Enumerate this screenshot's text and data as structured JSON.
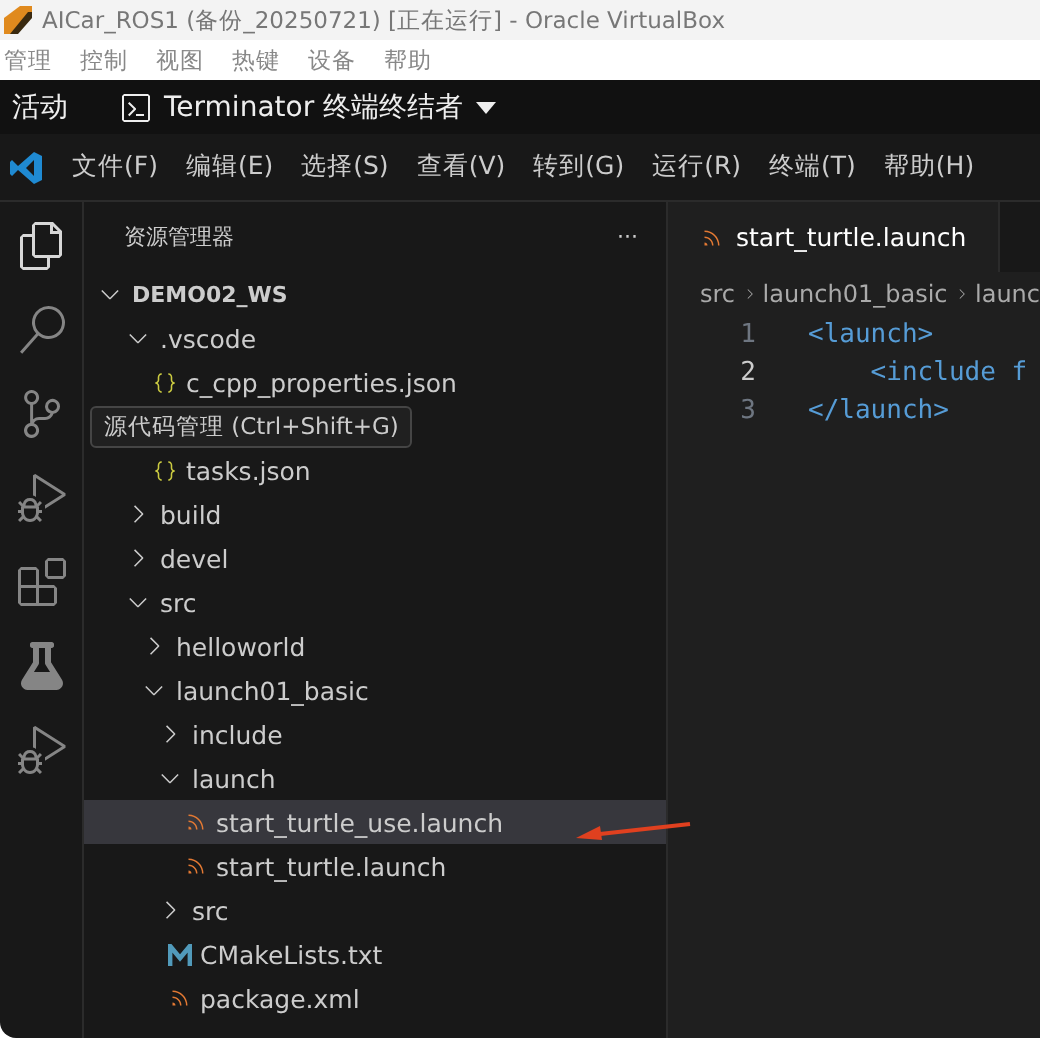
{
  "host_window": {
    "title": "AICar_ROS1 (备份_20250721) [正在运行] - Oracle VirtualBox",
    "menu": [
      "管理",
      "控制",
      "视图",
      "热键",
      "设备",
      "帮助"
    ]
  },
  "top_bar": {
    "activities": "活动",
    "app": "Terminator 终端终结者"
  },
  "editor_menu": [
    "文件(F)",
    "编辑(E)",
    "选择(S)",
    "查看(V)",
    "转到(G)",
    "运行(R)",
    "终端(T)",
    "帮助(H)"
  ],
  "activity_bar": [
    {
      "kind": "files",
      "selected": true
    },
    {
      "kind": "search",
      "selected": false
    },
    {
      "kind": "git",
      "selected": false
    },
    {
      "kind": "debug",
      "selected": false
    },
    {
      "kind": "extensions",
      "selected": false
    },
    {
      "kind": "flask",
      "selected": false
    },
    {
      "kind": "ros",
      "selected": false
    }
  ],
  "sidebar": {
    "title": "资源管理器",
    "more": "···",
    "tree": [
      {
        "kind": "folder",
        "label": "DEMO02_WS",
        "expanded": true,
        "selected": false,
        "children": [
          {
            "kind": "folder",
            "label": ".vscode",
            "expanded": true,
            "selected": false,
            "children": [
              {
                "kind": "json_file",
                "label": "c_cpp_properties.json",
                "selected": false
              },
              {
                "kind": "tooltip",
                "label": "源代码管理 (Ctrl+Shift+G)"
              },
              {
                "kind": "json_file",
                "label": "tasks.json",
                "selected": false
              }
            ]
          },
          {
            "kind": "folder",
            "label": "build",
            "expanded": false,
            "selected": false
          },
          {
            "kind": "folder",
            "label": "devel",
            "expanded": false,
            "selected": false
          },
          {
            "kind": "folder",
            "label": "src",
            "expanded": true,
            "selected": false,
            "children": [
              {
                "kind": "folder",
                "label": "helloworld",
                "expanded": false,
                "selected": false
              },
              {
                "kind": "folder",
                "label": "launch01_basic",
                "expanded": true,
                "selected": false,
                "children": [
                  {
                    "kind": "folder",
                    "label": "include",
                    "expanded": false,
                    "selected": false
                  },
                  {
                    "kind": "folder",
                    "label": "launch",
                    "expanded": true,
                    "selected": false,
                    "children": [
                      {
                        "kind": "feed_file",
                        "label": "start_turtle_use.launch",
                        "selected": true
                      },
                      {
                        "kind": "feed_file",
                        "label": "start_turtle.launch",
                        "selected": false
                      }
                    ]
                  },
                  {
                    "kind": "folder",
                    "label": "src",
                    "expanded": false,
                    "selected": false
                  },
                  {
                    "kind": "cmake_file",
                    "label": "CMakeLists.txt",
                    "selected": false
                  },
                  {
                    "kind": "feed_file",
                    "label": "package.xml",
                    "selected": false
                  }
                ]
              }
            ]
          }
        ]
      }
    ]
  },
  "editor": {
    "tabs": [
      {
        "label": "start_turtle.launch",
        "selected": true
      }
    ],
    "breadcrumb": [
      "src",
      "launch01_basic",
      "launc"
    ],
    "lines": [
      {
        "number": "1",
        "text": "<launch>",
        "current": false
      },
      {
        "number": "2",
        "text": "    <include f",
        "current": true
      },
      {
        "number": "3",
        "text": "</launch>",
        "current": false
      }
    ]
  }
}
